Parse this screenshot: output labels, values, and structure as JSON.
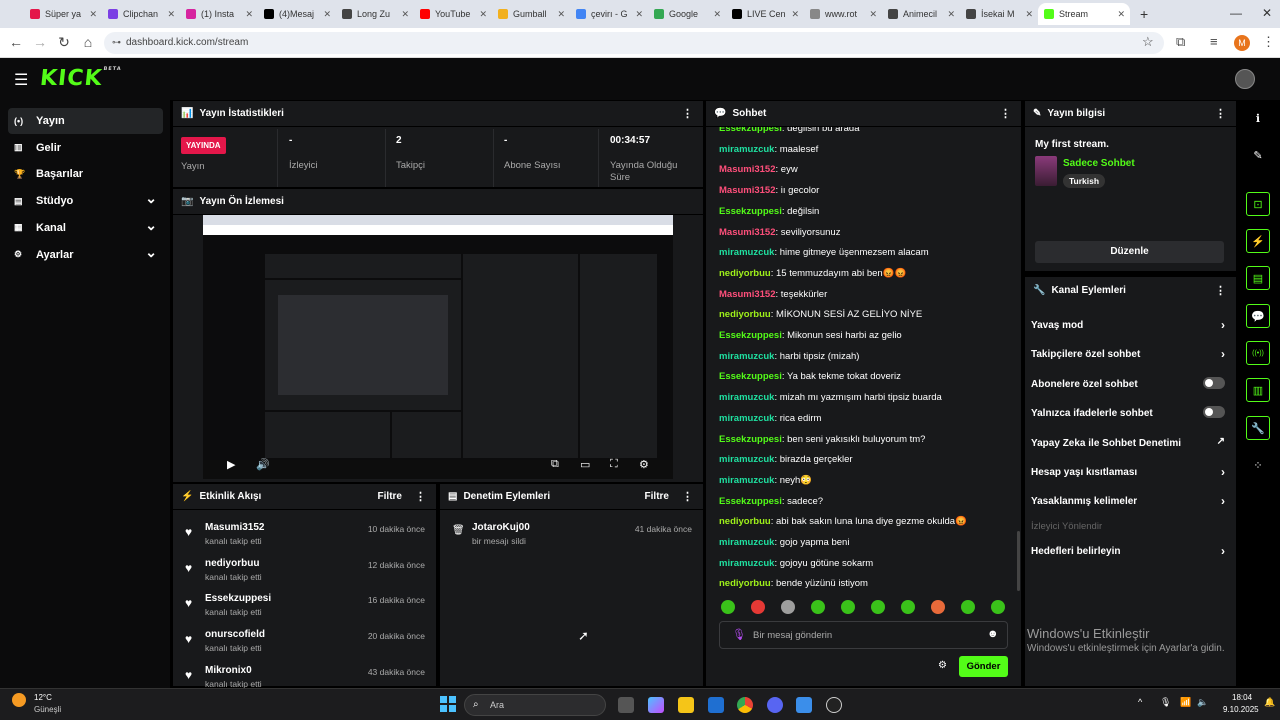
{
  "browser": {
    "tabs": [
      {
        "label": "Süper ya",
        "color": "#e4174a"
      },
      {
        "label": "Clipchan",
        "color": "#7b3fe4"
      },
      {
        "label": "(1) Insta",
        "color": "#d6249f"
      },
      {
        "label": "(4)Mesaj",
        "color": "#000000"
      },
      {
        "label": "Long Zu",
        "color": "#444444"
      },
      {
        "label": "YouTube",
        "color": "#ff0000"
      },
      {
        "label": "Gumball",
        "color": "#f2b01e"
      },
      {
        "label": "çevirı - G",
        "color": "#4285f4"
      },
      {
        "label": "Google",
        "color": "#34a853"
      },
      {
        "label": "LIVE Cen",
        "color": "#000000"
      },
      {
        "label": "www.rot",
        "color": "#888888"
      },
      {
        "label": "Animecil",
        "color": "#444444"
      },
      {
        "label": "İsekai M",
        "color": "#444444"
      },
      {
        "label": "Stream",
        "color": "#53fc18"
      }
    ],
    "url": "dashboard.kick.com/stream",
    "profile_initial": "M"
  },
  "kick": {
    "logo": "KICK",
    "beta": "BETA"
  },
  "sidebar": {
    "items": [
      {
        "label": "Yayın",
        "icon": "(•)"
      },
      {
        "label": "Gelir",
        "icon": "▥"
      },
      {
        "label": "Başarılar",
        "icon": "🏆"
      },
      {
        "label": "Stüdyo",
        "icon": "▤"
      },
      {
        "label": "Kanal",
        "icon": "▦"
      },
      {
        "label": "Ayarlar",
        "icon": "⚙"
      }
    ]
  },
  "stats": {
    "title": "Yayın İstatistikleri",
    "live": "YAYINDA",
    "live_label": "Yayın",
    "viewers_value": "-",
    "viewers_label": "İzleyici",
    "followers_value": "2",
    "followers_label": "Takipçi",
    "subs_value": "-",
    "subs_label": "Abone Sayısı",
    "duration_value": "00:34:57",
    "duration_label_1": "Yayında Olduğu",
    "duration_label_2": "Süre"
  },
  "preview": {
    "title": "Yayın Ön İzlemesi"
  },
  "activity": {
    "title": "Etkinlik Akışı",
    "filter": "Filtre",
    "rows": [
      {
        "name": "Masumi3152",
        "sub": "kanalı takip etti",
        "time": "10 dakika önce"
      },
      {
        "name": "nediyorbuu",
        "sub": "kanalı takip etti",
        "time": "12 dakika önce"
      },
      {
        "name": "Essekzuppesi",
        "sub": "kanalı takip etti",
        "time": "16 dakika önce"
      },
      {
        "name": "onurscofield",
        "sub": "kanalı takip etti",
        "time": "20 dakika önce"
      },
      {
        "name": "Mikronix0",
        "sub": "kanalı takip etti",
        "time": "43 dakika önce"
      }
    ]
  },
  "moderation": {
    "title": "Denetim Eylemleri",
    "filter": "Filtre",
    "rows": [
      {
        "name": "JotaroKuj00",
        "sub": "bir mesajı sildi",
        "time": "41 dakika önce"
      }
    ]
  },
  "chat": {
    "title": "Sohbet",
    "messages": [
      {
        "user": "Essekzuppesi",
        "color": "#53fc18",
        "text": "değilsin bu arada"
      },
      {
        "user": "miramuzcuk",
        "color": "#1fe0a0",
        "text": "maalesef"
      },
      {
        "user": "Masumi3152",
        "color": "#ff4f7b",
        "text": "eyw"
      },
      {
        "user": "Masumi3152",
        "color": "#ff4f7b",
        "text": "iı gecolor"
      },
      {
        "user": "Essekzuppesi",
        "color": "#53fc18",
        "text": "değilsin"
      },
      {
        "user": "Masumi3152",
        "color": "#ff4f7b",
        "text": "seviliyorsunuz"
      },
      {
        "user": "miramuzcuk",
        "color": "#1fe0a0",
        "text": "hime gitmeye üşenmezsem alacam"
      },
      {
        "user": "nediyorbuu",
        "color": "#9ef01a",
        "text": "15 temmuzdayım abi ben😡😡"
      },
      {
        "user": "Masumi3152",
        "color": "#ff4f7b",
        "text": "teşekkürler"
      },
      {
        "user": "nediyorbuu",
        "color": "#9ef01a",
        "text": "MİKONUN SESİ AZ GELİYO NİYE"
      },
      {
        "user": "Essekzuppesi",
        "color": "#53fc18",
        "text": "Mikonun sesi harbi az gelio"
      },
      {
        "user": "miramuzcuk",
        "color": "#1fe0a0",
        "text": "harbi tipsiz (mizah)"
      },
      {
        "user": "Essekzuppesi",
        "color": "#53fc18",
        "text": "Ya bak tekme tokat doveriz"
      },
      {
        "user": "miramuzcuk",
        "color": "#1fe0a0",
        "text": "mizah mı yazmışım harbi tipsiz buarda"
      },
      {
        "user": "miramuzcuk",
        "color": "#1fe0a0",
        "text": "rica edirm"
      },
      {
        "user": "Essekzuppesi",
        "color": "#53fc18",
        "text": "ben seni yakısıklı buluyorum tm?"
      },
      {
        "user": "miramuzcuk",
        "color": "#1fe0a0",
        "text": "birazda gerçekler"
      },
      {
        "user": "miramuzcuk",
        "color": "#1fe0a0",
        "text": "neyh😳"
      },
      {
        "user": "Essekzuppesi",
        "color": "#53fc18",
        "text": "sadece?"
      },
      {
        "user": "nediyorbuu",
        "color": "#9ef01a",
        "text": "abi bak sakın luna luna diye gezme okulda😡"
      },
      {
        "user": "miramuzcuk",
        "color": "#1fe0a0",
        "text": "gojo yapma beni"
      },
      {
        "user": "miramuzcuk",
        "color": "#1fe0a0",
        "text": "gojoyu götüne sokarm"
      },
      {
        "user": "nediyorbuu",
        "color": "#9ef01a",
        "text": "bende yüzünü istiyom"
      }
    ],
    "placeholder": "Bir mesaj gönderin",
    "send": "Gönder"
  },
  "info": {
    "title": "Yayın bilgisi",
    "stream_title": "My first stream.",
    "category": "Sadece Sohbet",
    "language": "Turkish",
    "edit": "Düzenle"
  },
  "channel_actions": {
    "title": "Kanal Eylemleri",
    "items": [
      {
        "label": "Yavaş mod",
        "control": "arrow"
      },
      {
        "label": "Takipçilere özel sohbet",
        "control": "arrow"
      },
      {
        "label": "Abonelere özel sohbet",
        "control": "toggle"
      },
      {
        "label": "Yalnızca ifadelerle sohbet",
        "control": "toggle"
      },
      {
        "label": "Yapay Zeka ile Sohbet Denetimi",
        "control": "external"
      },
      {
        "label": "Hesap yaşı kısıtlaması",
        "control": "arrow"
      },
      {
        "label": "Yasaklanmış kelimeler",
        "control": "arrow"
      }
    ],
    "viewer_goals": "İzleyici Yönlendir",
    "set_goals": "Hedefleri belirleyin"
  },
  "windows": {
    "activate_title": "Windows'u Etkinleştir",
    "activate_sub": "Windows'u etkinleştirmek için Ayarlar'a gidin.",
    "weather_temp": "12°C",
    "weather_desc": "Güneşli",
    "search": "Ara",
    "time": "18:04",
    "date": "9.10.2025"
  }
}
